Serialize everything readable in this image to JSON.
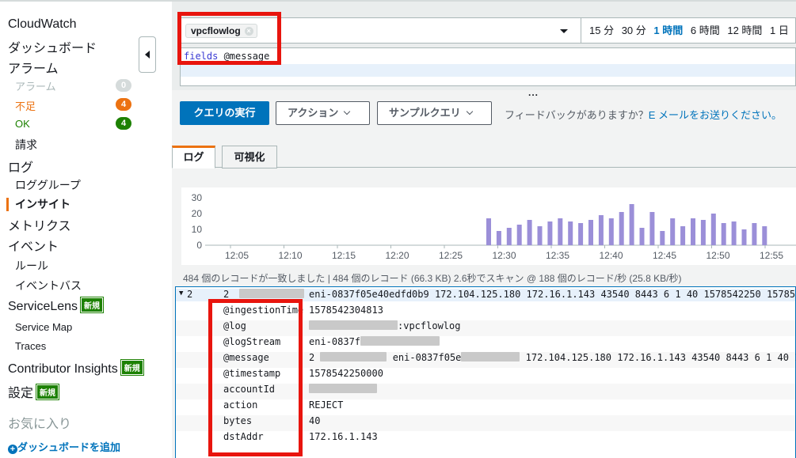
{
  "sidebar": {
    "items": [
      {
        "label": "CloudWatch"
      },
      {
        "label": "ダッシュボード"
      },
      {
        "label": "アラーム"
      },
      {
        "label": "アラーム",
        "count": "0"
      },
      {
        "label": "不足",
        "count": "4"
      },
      {
        "label": "OK",
        "count": "4"
      },
      {
        "label": "請求"
      },
      {
        "label": "ログ"
      },
      {
        "label": "ロググループ"
      },
      {
        "label": "インサイト"
      },
      {
        "label": "メトリクス"
      },
      {
        "label": "イベント"
      },
      {
        "label": "ルール"
      },
      {
        "label": "イベントバス"
      },
      {
        "label": "ServiceLens",
        "tag": "新規"
      },
      {
        "label": "Service Map"
      },
      {
        "label": "Traces"
      },
      {
        "label": "Contributor Insights",
        "tag": "新規"
      },
      {
        "label": "設定",
        "tag": "新規"
      },
      {
        "label": "お気に入り"
      },
      {
        "label": "ダッシュボードを追加"
      }
    ],
    "colors": {
      "inactive": "#aab7b8",
      "warning": "#ec7211",
      "ok": "#1d8102"
    }
  },
  "query": {
    "log_group_chip": "vpcflowlog",
    "time_options": [
      "15 分",
      "30 分",
      "1 時間",
      "6 時間",
      "12 時間",
      "1 日"
    ],
    "selected_time": "1 時間",
    "editor_keyword": "fields",
    "editor_rest": " @message",
    "more": "...",
    "run_button": "クエリの実行",
    "actions_button": "アクション",
    "sample_button": "サンプルクエリ",
    "feedback_text": "フィードバックがありますか？",
    "feedback_link": "E メールをお送りください。"
  },
  "tabs": [
    "ログ",
    "可視化"
  ],
  "chart_data": {
    "type": "bar",
    "x": [
      "12:05",
      "12:10",
      "12:15",
      "12:20",
      "12:25",
      "12:30",
      "12:35",
      "12:40",
      "12:45",
      "12:50",
      "12:55"
    ],
    "yticks": [
      "30",
      "20",
      "10",
      "0"
    ],
    "ylim": [
      0,
      30
    ],
    "values": [
      17,
      9,
      11,
      13,
      16,
      12,
      15,
      17,
      15,
      14,
      16,
      19,
      17,
      21,
      26,
      11,
      21,
      9,
      17,
      12,
      17,
      16,
      20,
      14,
      15,
      10,
      14,
      12
    ],
    "bar_color": "#9b8fd8"
  },
  "stats_line": "484 個のレコードが一致しました | 484 個のレコード (66.3 KB) 2.6秒でスキャン @ 188 個のレコード/秒 (25.8 KB/秒)",
  "results": {
    "row_index": "2",
    "row_col1": "2",
    "row_summary": "eni-0837f05e40edfd0b9 172.104.125.180 172.16.1.143 43540 8443 6 1 40 1578542250 1578542",
    "fields": [
      {
        "key": "@ingestionTime",
        "value": "1578542304813"
      },
      {
        "key": "@log",
        "value": ":vpcflowlog"
      },
      {
        "key": "@logStream",
        "value": "eni-0837f"
      },
      {
        "key": "@message",
        "value": "2",
        "value2": "eni-0837f05e",
        "value3": "172.104.125.180 172.16.1.143 43540 8443 6 1 40 157"
      },
      {
        "key": "@timestamp",
        "value": "1578542250000"
      },
      {
        "key": "accountId",
        "value": ""
      },
      {
        "key": "action",
        "value": "REJECT"
      },
      {
        "key": "bytes",
        "value": "40"
      },
      {
        "key": "dstAddr",
        "value": "172.16.1.143"
      }
    ]
  }
}
